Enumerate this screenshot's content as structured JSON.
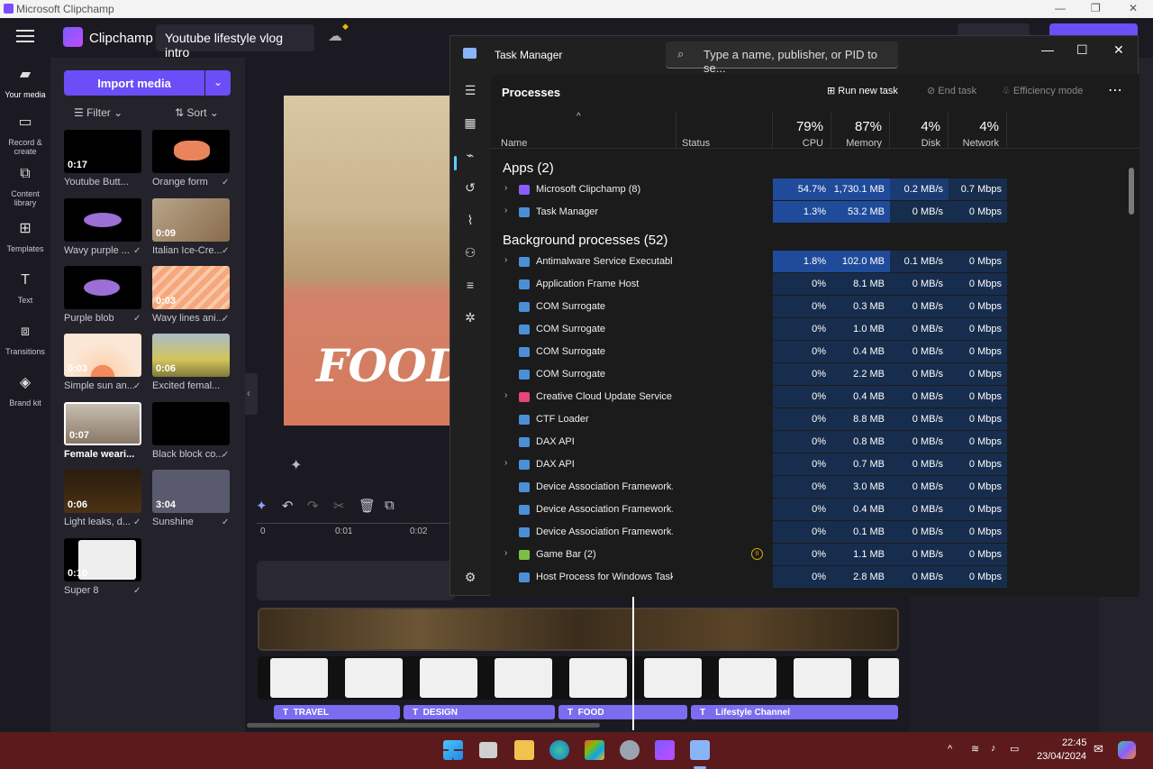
{
  "clipchamp": {
    "window_title": "Microsoft Clipchamp",
    "app_name": "Clipchamp",
    "project_name": "Youtube lifestyle vlog intro",
    "rail": [
      {
        "label": "Your media",
        "icon": "folder-icon"
      },
      {
        "label": "Record & create",
        "icon": "camera-icon"
      },
      {
        "label": "Content library",
        "icon": "library-icon"
      },
      {
        "label": "Templates",
        "icon": "grid-icon"
      },
      {
        "label": "Text",
        "icon": "text-icon"
      },
      {
        "label": "Transitions",
        "icon": "transition-icon"
      },
      {
        "label": "Brand kit",
        "icon": "brand-icon"
      }
    ],
    "import_label": "Import media",
    "filter_label": "Filter",
    "sort_label": "Sort",
    "media": [
      {
        "caption": "Youtube Butt...",
        "duration": "0:17",
        "bold": false
      },
      {
        "caption": "Orange form",
        "duration": "",
        "bold": false
      },
      {
        "caption": "Wavy purple ...",
        "duration": "",
        "bold": false
      },
      {
        "caption": "Italian Ice-Cre...",
        "duration": "0:09",
        "bold": false
      },
      {
        "caption": "Purple blob",
        "duration": "",
        "bold": false
      },
      {
        "caption": "Wavy lines ani...",
        "duration": "0:03",
        "bold": false
      },
      {
        "caption": "Simple sun an...",
        "duration": "0:03",
        "bold": false
      },
      {
        "caption": "Excited femal...",
        "duration": "0:06",
        "bold": false
      },
      {
        "caption": "Female weari...",
        "duration": "0:07",
        "bold": true
      },
      {
        "caption": "Black block co...",
        "duration": "",
        "bold": false
      },
      {
        "caption": "Light leaks, d...",
        "duration": "0:06",
        "bold": false
      },
      {
        "caption": "Sunshine",
        "duration": "3:04",
        "bold": false
      },
      {
        "caption": "Super 8",
        "duration": "0:10",
        "bold": false
      }
    ],
    "preview_text": "FOOD",
    "ruler": [
      "0",
      "0:01",
      "0:02"
    ],
    "text_clips": [
      "TRAVEL",
      "DESIGN",
      "FOOD",
      "Lifestyle Channel"
    ]
  },
  "taskmgr": {
    "title": "Task Manager",
    "search_placeholder": "Type a name, publisher, or PID to se...",
    "page_title": "Processes",
    "run_new_task": "Run new task",
    "end_task": "End task",
    "efficiency_mode": "Efficiency mode",
    "columns": {
      "name": "Name",
      "status": "Status",
      "cpu_pct": "79%",
      "cpu": "CPU",
      "mem_pct": "87%",
      "mem": "Memory",
      "disk_pct": "4%",
      "disk": "Disk",
      "net_pct": "4%",
      "net": "Network"
    },
    "apps_header": "Apps (2)",
    "apps": [
      {
        "name": "Microsoft Clipchamp (8)",
        "cpu": "54.7%",
        "mem": "1,730.1 MB",
        "disk": "0.2 MB/s",
        "net": "0.7 Mbps",
        "expand": true
      },
      {
        "name": "Task Manager",
        "cpu": "1.3%",
        "mem": "53.2 MB",
        "disk": "0 MB/s",
        "net": "0 Mbps",
        "expand": true
      }
    ],
    "bg_header": "Background processes (52)",
    "bg": [
      {
        "name": "Antimalware Service Executable",
        "cpu": "1.8%",
        "mem": "102.0 MB",
        "disk": "0.1 MB/s",
        "net": "0 Mbps",
        "expand": true
      },
      {
        "name": "Application Frame Host",
        "cpu": "0%",
        "mem": "8.1 MB",
        "disk": "0 MB/s",
        "net": "0 Mbps",
        "expand": false
      },
      {
        "name": "COM Surrogate",
        "cpu": "0%",
        "mem": "0.3 MB",
        "disk": "0 MB/s",
        "net": "0 Mbps",
        "expand": false
      },
      {
        "name": "COM Surrogate",
        "cpu": "0%",
        "mem": "1.0 MB",
        "disk": "0 MB/s",
        "net": "0 Mbps",
        "expand": false
      },
      {
        "name": "COM Surrogate",
        "cpu": "0%",
        "mem": "0.4 MB",
        "disk": "0 MB/s",
        "net": "0 Mbps",
        "expand": false
      },
      {
        "name": "COM Surrogate",
        "cpu": "0%",
        "mem": "2.2 MB",
        "disk": "0 MB/s",
        "net": "0 Mbps",
        "expand": false
      },
      {
        "name": "Creative Cloud Update Service",
        "cpu": "0%",
        "mem": "0.4 MB",
        "disk": "0 MB/s",
        "net": "0 Mbps",
        "expand": true
      },
      {
        "name": "CTF Loader",
        "cpu": "0%",
        "mem": "8.8 MB",
        "disk": "0 MB/s",
        "net": "0 Mbps",
        "expand": false
      },
      {
        "name": "DAX API",
        "cpu": "0%",
        "mem": "0.8 MB",
        "disk": "0 MB/s",
        "net": "0 Mbps",
        "expand": false
      },
      {
        "name": "DAX API",
        "cpu": "0%",
        "mem": "0.7 MB",
        "disk": "0 MB/s",
        "net": "0 Mbps",
        "expand": true
      },
      {
        "name": "Device Association Framework...",
        "cpu": "0%",
        "mem": "3.0 MB",
        "disk": "0 MB/s",
        "net": "0 Mbps",
        "expand": false
      },
      {
        "name": "Device Association Framework...",
        "cpu": "0%",
        "mem": "0.4 MB",
        "disk": "0 MB/s",
        "net": "0 Mbps",
        "expand": false
      },
      {
        "name": "Device Association Framework...",
        "cpu": "0%",
        "mem": "0.1 MB",
        "disk": "0 MB/s",
        "net": "0 Mbps",
        "expand": false
      },
      {
        "name": "Game Bar (2)",
        "cpu": "0%",
        "mem": "1.1 MB",
        "disk": "0 MB/s",
        "net": "0 Mbps",
        "expand": true
      },
      {
        "name": "Host Process for Windows Tasks",
        "cpu": "0%",
        "mem": "2.8 MB",
        "disk": "0 MB/s",
        "net": "0 Mbps",
        "expand": false
      }
    ]
  },
  "taskbar": {
    "time": "22:45",
    "date": "23/04/2024"
  },
  "colors": {
    "accent": "#6b4ef7",
    "tm_highlight_strong": "#1f4b9a",
    "tm_highlight_light": "#172d4d"
  }
}
